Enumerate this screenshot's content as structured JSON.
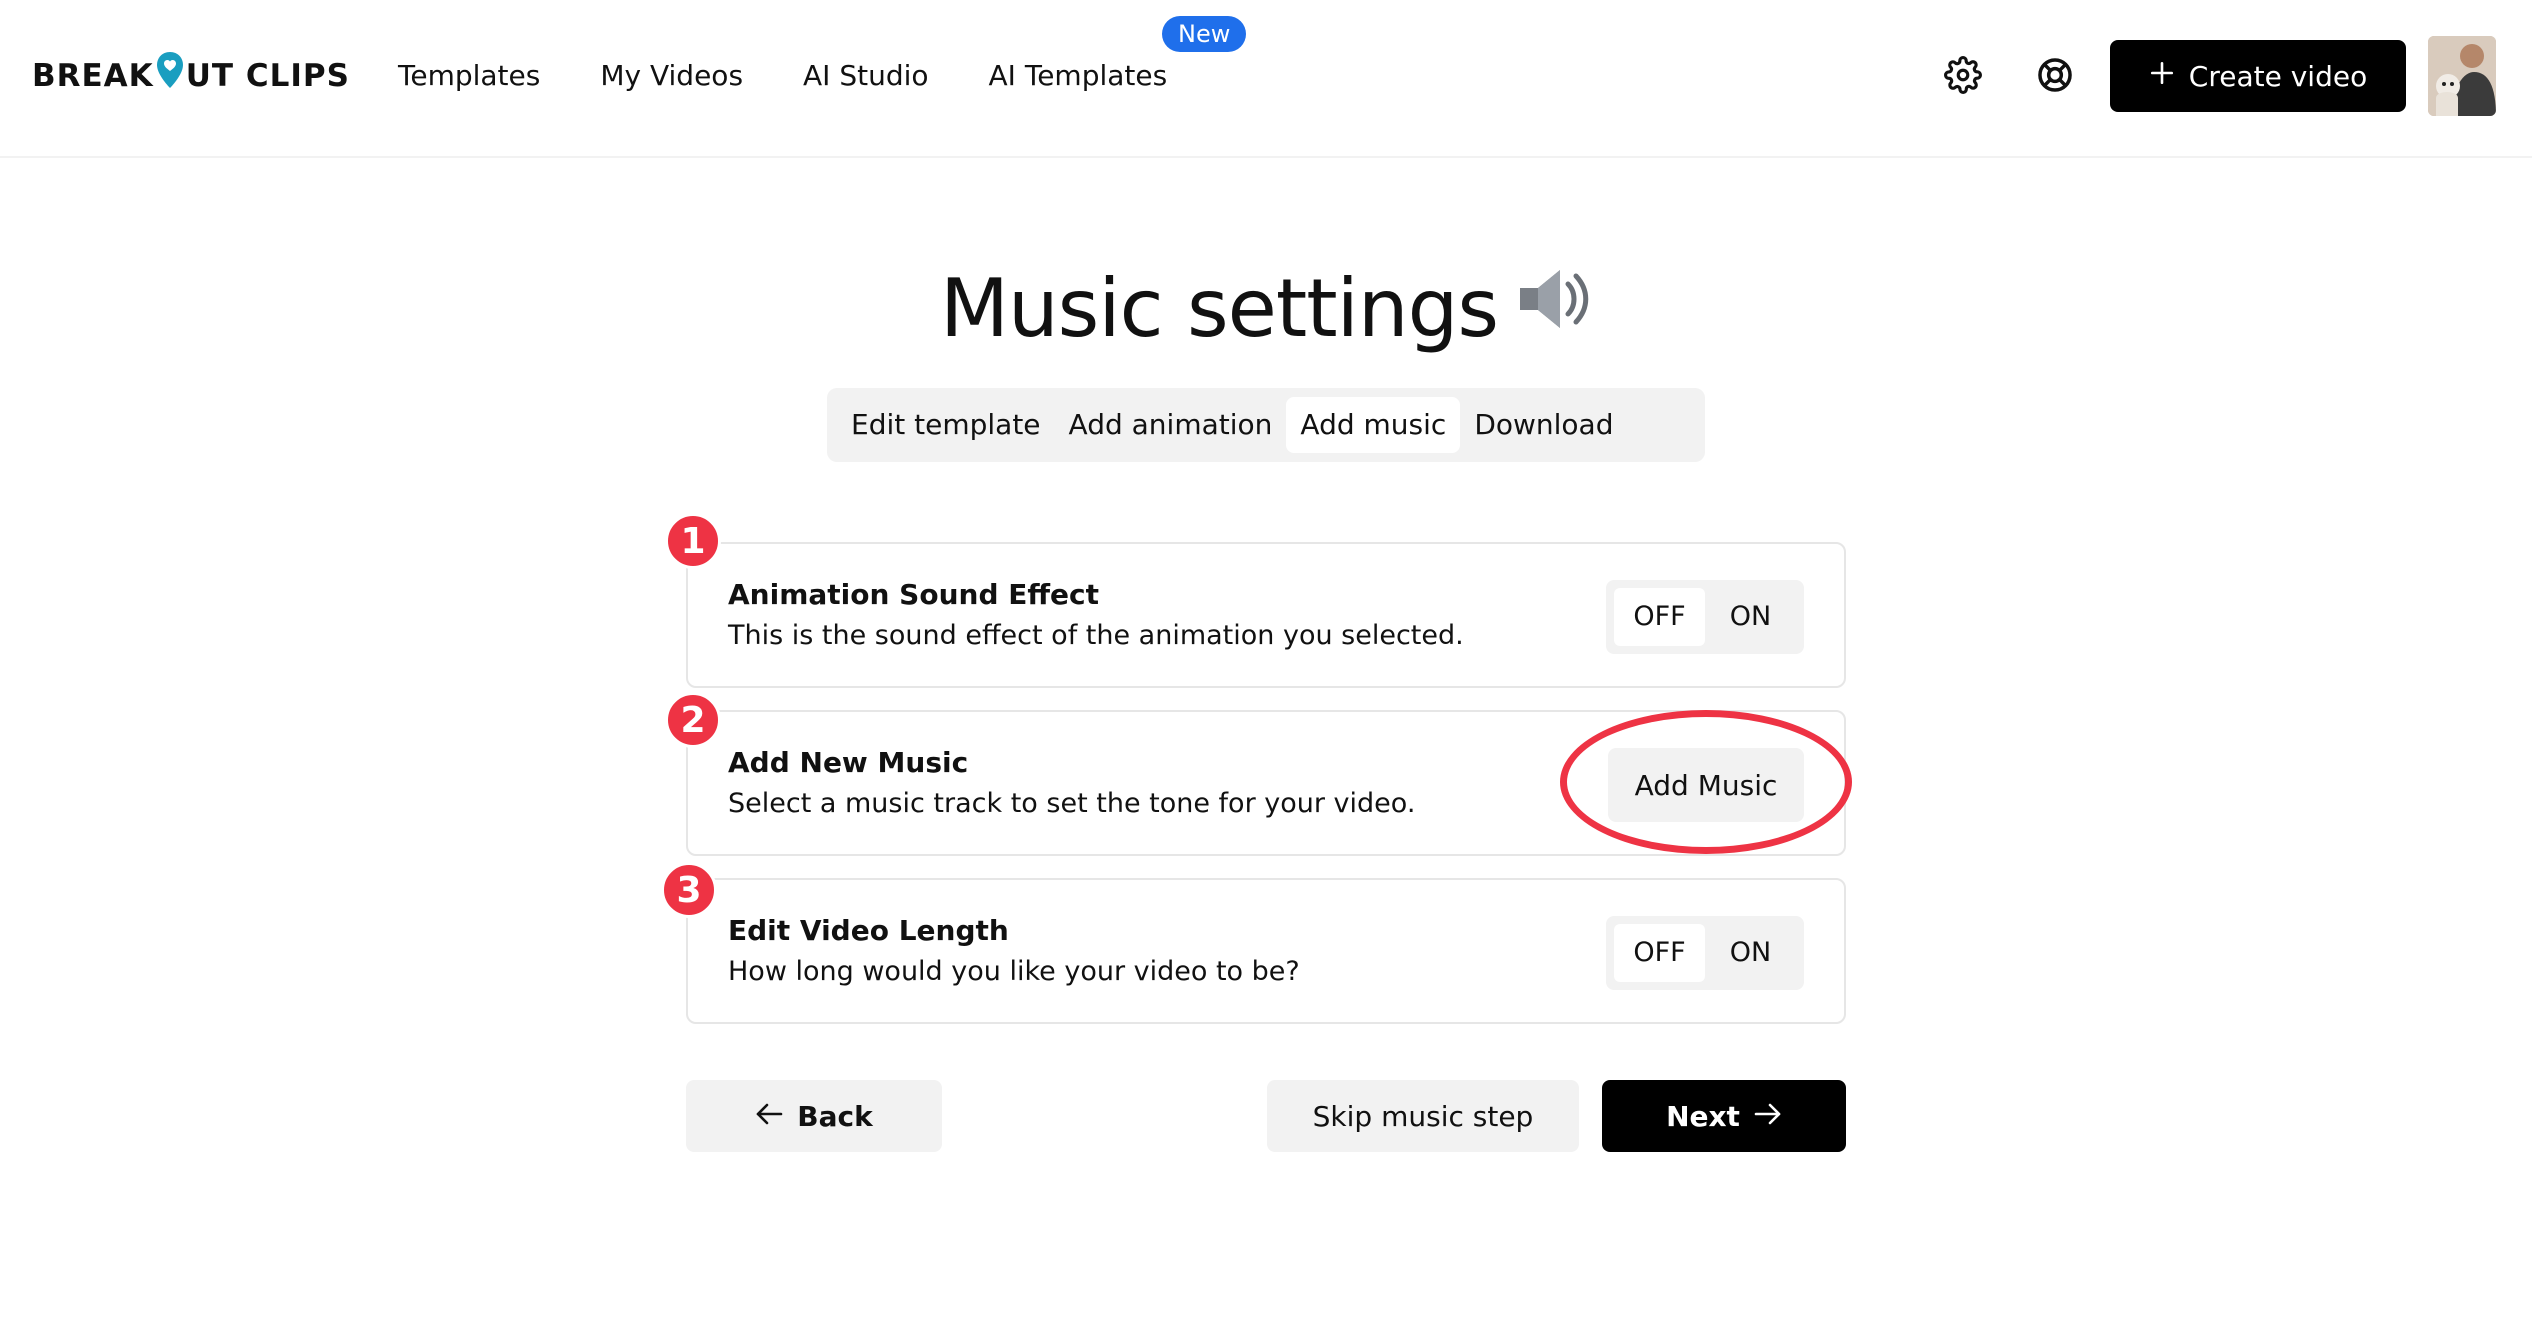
{
  "header": {
    "logo_left": "BREAK",
    "logo_right": "UT CLIPS",
    "nav": [
      "Templates",
      "My Videos",
      "AI Studio",
      "AI Templates"
    ],
    "new_badge": "New",
    "create_label": "Create video"
  },
  "page": {
    "title": "Music settings",
    "steps": [
      "Edit template",
      "Add animation",
      "Add music",
      "Download"
    ],
    "active_step": "Add music"
  },
  "cards": [
    {
      "number": "1",
      "title": "Animation Sound Effect",
      "description": "This is the sound effect of the animation you selected.",
      "toggle": {
        "off": "OFF",
        "on": "ON",
        "selected": "OFF"
      }
    },
    {
      "number": "2",
      "title": "Add New Music",
      "description": "Select a music track to set the tone for your video.",
      "button": "Add Music"
    },
    {
      "number": "3",
      "title": "Edit Video Length",
      "description": "How long would you like your video to be?",
      "toggle": {
        "off": "OFF",
        "on": "ON",
        "selected": "OFF"
      }
    }
  ],
  "footer": {
    "back": "Back",
    "skip": "Skip music step",
    "next": "Next"
  },
  "colors": {
    "accent_red": "#ee3344",
    "badge_blue": "#1f6feb",
    "logo_teal": "#1a9ec0"
  }
}
